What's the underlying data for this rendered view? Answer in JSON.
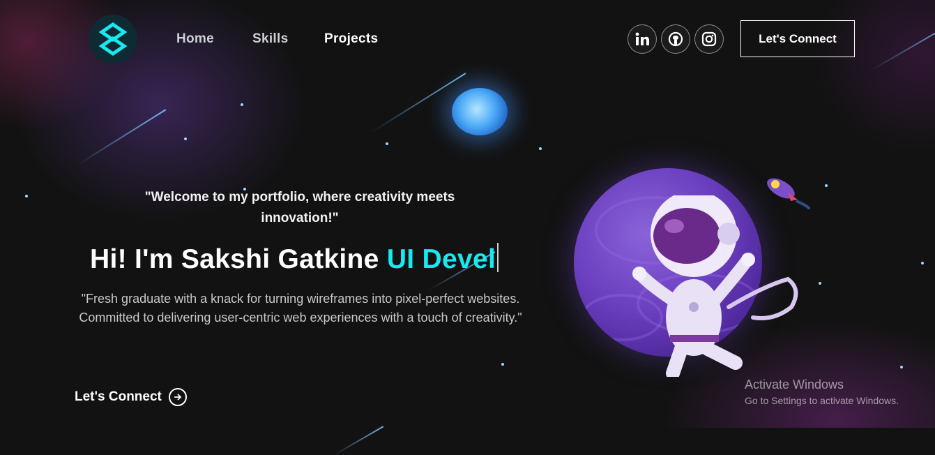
{
  "nav": {
    "links": [
      "Home",
      "Skills",
      "Projects"
    ],
    "connect_label": "Let's Connect"
  },
  "social": [
    "linkedin-icon",
    "github-icon",
    "instagram-icon"
  ],
  "hero": {
    "tagline": "\"Welcome to my portfolio, where creativity meets innovation!\"",
    "headline_static": "Hi! I'm Sakshi Gatkine ",
    "headline_typed": "UI Devel",
    "description": "\"Fresh graduate with a knack for turning wireframes into pixel-perfect websites. Committed to delivering user-centric web experiences with a touch of creativity.\"",
    "cta_label": "Let's Connect"
  },
  "system": {
    "activate_title": "Activate Windows",
    "activate_sub": "Go to Settings to activate Windows."
  },
  "colors": {
    "accent": "#19e8ef",
    "background": "#121212",
    "planet": "#6b3fc0"
  }
}
